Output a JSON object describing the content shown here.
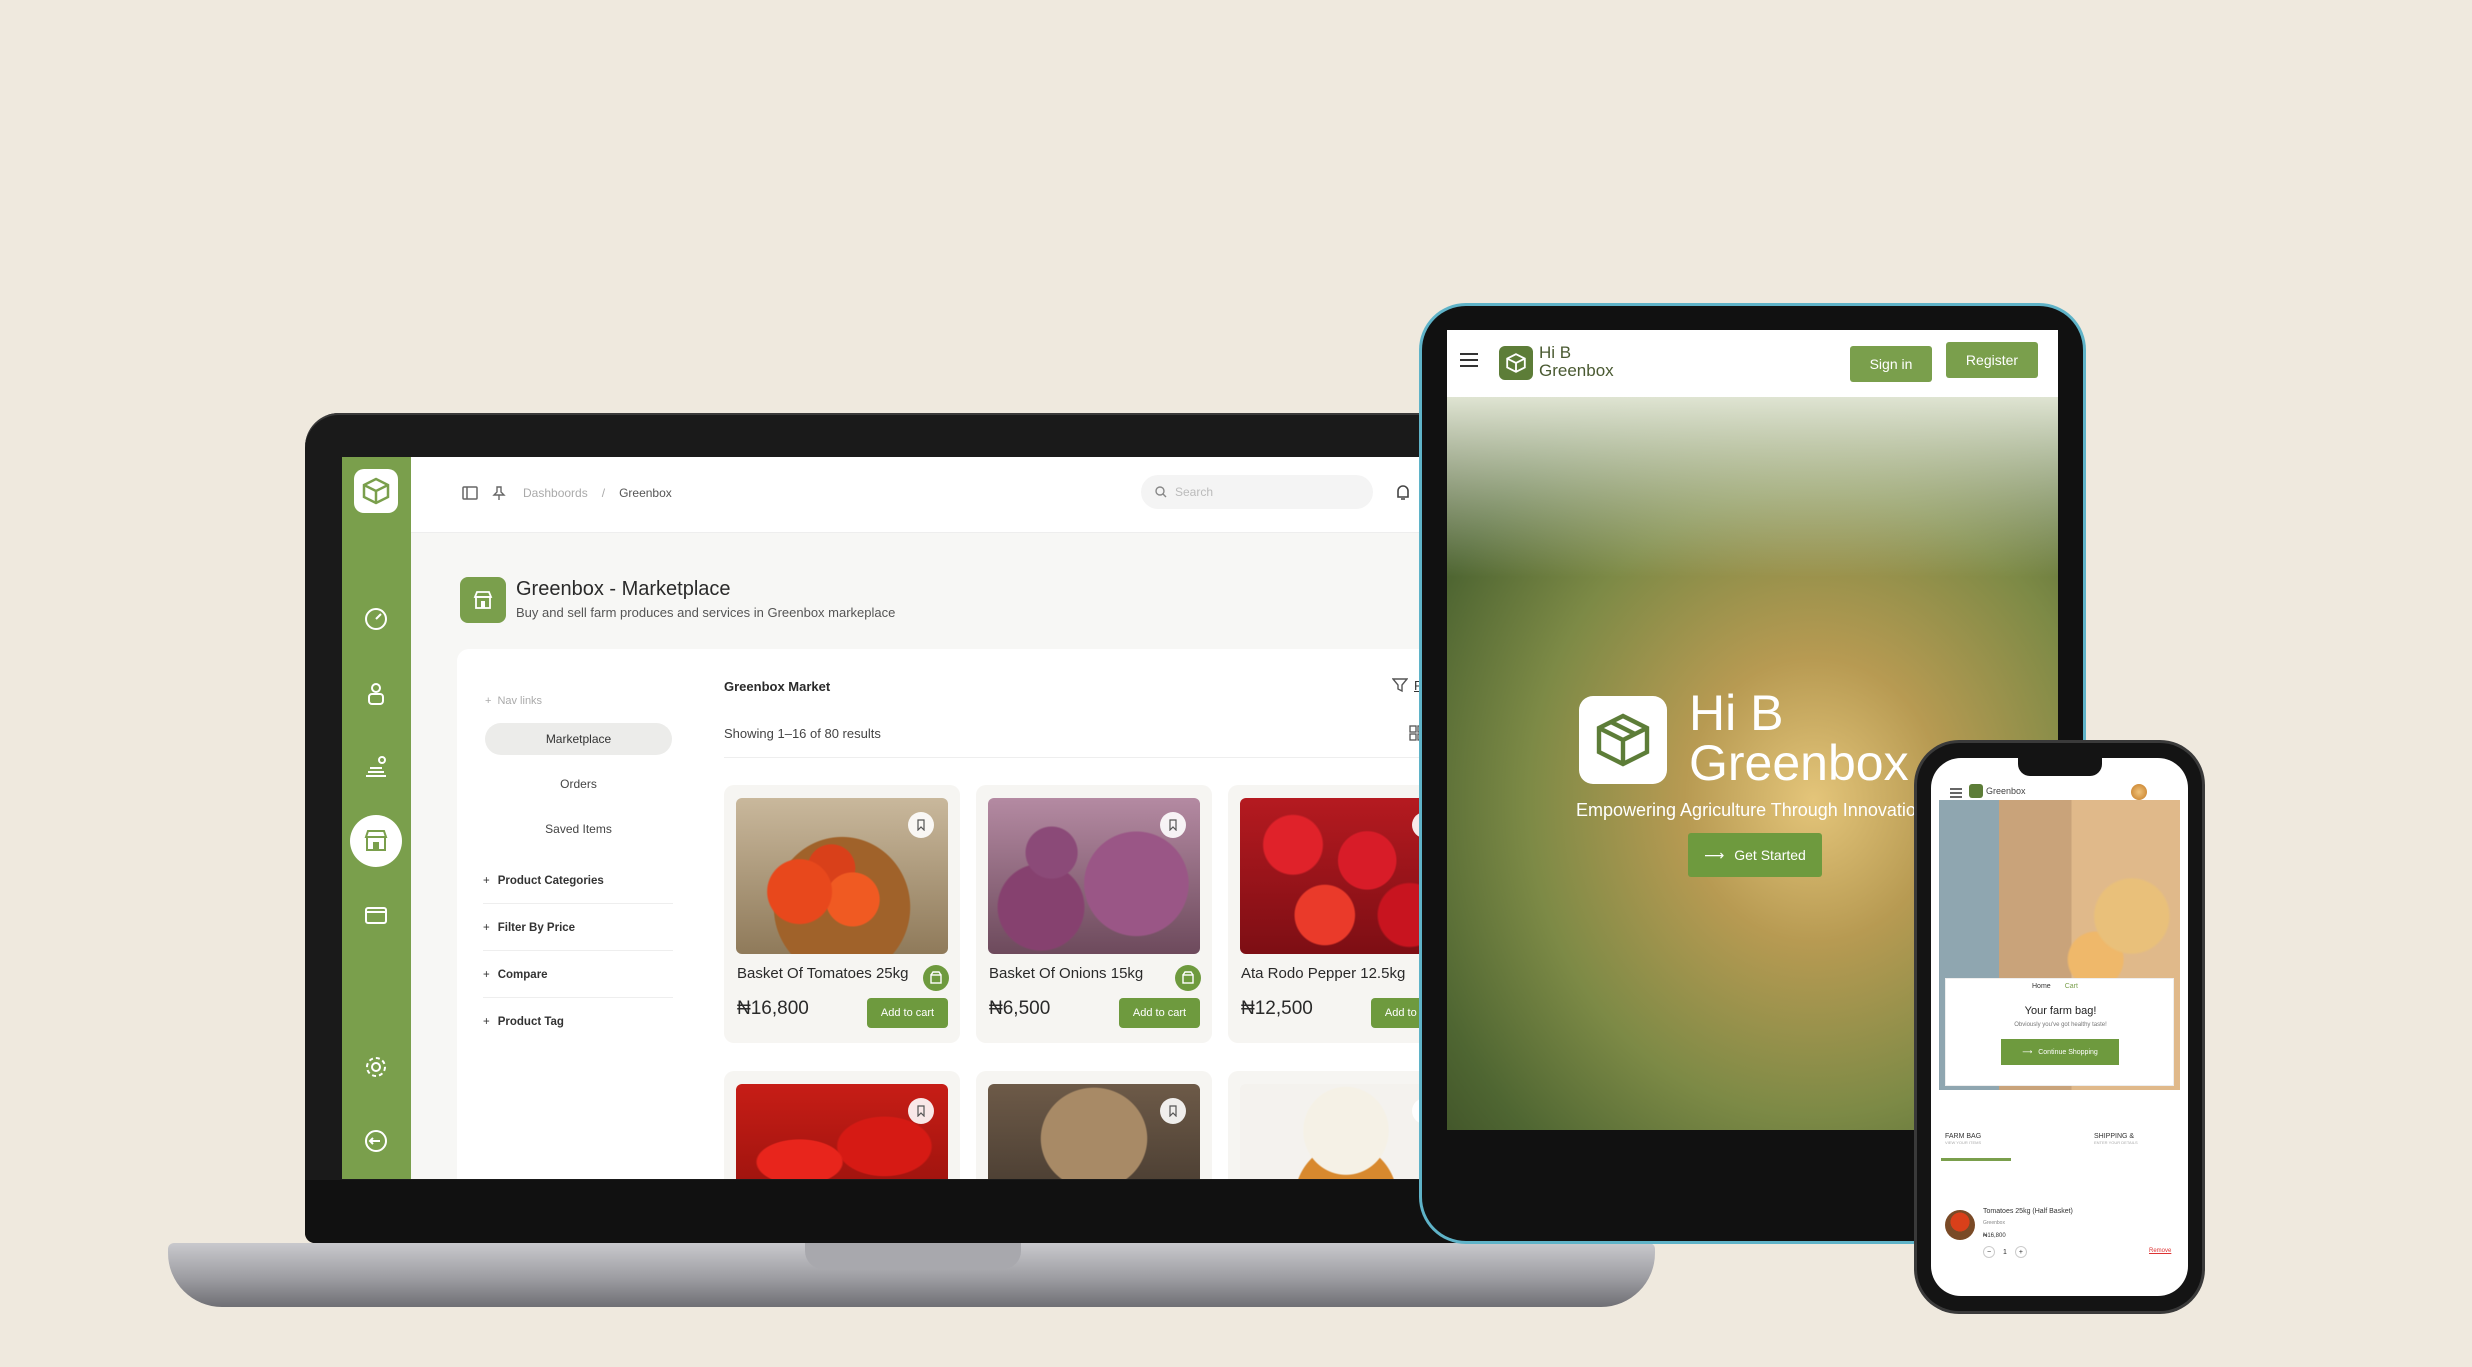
{
  "laptop": {
    "breadcrumb": {
      "parent": "Dashboords",
      "separator": "/",
      "current": "Greenbox"
    },
    "search_placeholder": "Search",
    "page": {
      "title": "Greenbox - Marketplace",
      "subtitle": "Buy and sell farm produces and services in Greenbox markeplace"
    },
    "nav": {
      "heading": "Nav links",
      "items": [
        "Marketplace",
        "Orders",
        "Saved Items"
      ],
      "filters": [
        "Product Categories",
        "Filter By Price",
        "Compare",
        "Product Tag"
      ]
    },
    "market": {
      "title": "Greenbox Market",
      "filter_label": "Filter by",
      "results": "Showing 1–16 of 80 results",
      "add_to_cart": "Add to cart",
      "products": [
        {
          "name": "Basket Of Tomatoes 25kg",
          "price": "₦16,800"
        },
        {
          "name": "Basket Of Onions 15kg",
          "price": "₦6,500"
        },
        {
          "name": "Ata Rodo Pepper 12.5kg",
          "price": "₦12,500"
        }
      ]
    },
    "colors": {
      "brand": "#7a9f4c",
      "button": "#6e9a3e"
    }
  },
  "tablet": {
    "logo_line1": "Hi B",
    "logo_line2": "Greenbox",
    "sign_in": "Sign in",
    "register": "Register",
    "hero_line1": "Hi B",
    "hero_line2": "Greenbox",
    "tagline": "Empowering Agriculture Through Innovatio",
    "cta": "Get Started"
  },
  "phone": {
    "brand": "Greenbox",
    "tabs": [
      "Home",
      "Cart"
    ],
    "bag_title": "Your farm bag!",
    "bag_sub": "Obviously you've got healthy taste!",
    "continue": "Continue Shopping",
    "steps": [
      {
        "label": "FARM BAG",
        "sub": "VIEW YOUR ITEMS"
      },
      {
        "label": "SHIPPING &",
        "sub": "ENTER YOUR DETAILS"
      }
    ],
    "item": {
      "name": "Tomatoes 25kg (Half Basket)",
      "seller": "Greenbox",
      "price": "₦16,800",
      "qty": "1",
      "remove": "Remove"
    }
  }
}
